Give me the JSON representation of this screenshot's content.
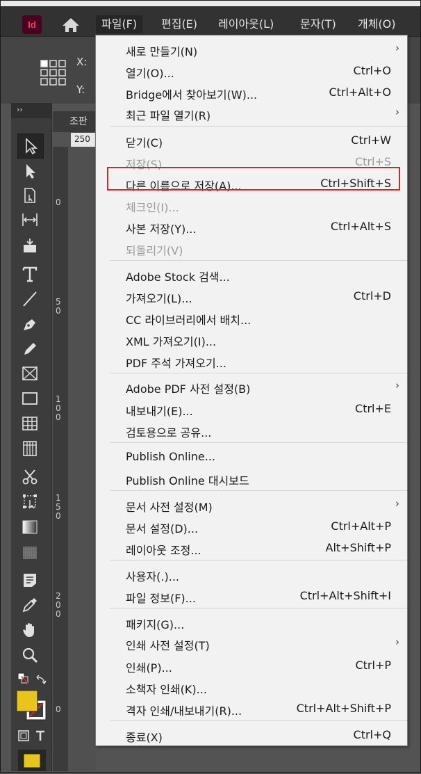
{
  "app": {
    "icon_label": "Id"
  },
  "menubar": {
    "items": [
      {
        "label": "파일(F)"
      },
      {
        "label": "편집(E)"
      },
      {
        "label": "레이아웃(L)"
      },
      {
        "label": "문자(T)"
      },
      {
        "label": "개체(O)"
      }
    ]
  },
  "controlbar": {
    "x_label": "X:",
    "y_label": "Y:"
  },
  "tools": {
    "collapse_label": "››"
  },
  "document": {
    "tab_label": "조판",
    "ruler_h": "250",
    "ruler_v": [
      "0",
      "5 0",
      "1 0 0",
      "1 5 0",
      "2 0 0",
      "0"
    ]
  },
  "file_menu": {
    "items": [
      {
        "label": "새로 만들기(N)",
        "shortcut": "",
        "submenu": "›"
      },
      {
        "label": "열기(O)...",
        "shortcut": "Ctrl+O"
      },
      {
        "label": "Bridge에서 찾아보기(W)...",
        "shortcut": "Ctrl+Alt+O"
      },
      {
        "label": "최근 파일 열기(R)",
        "shortcut": "",
        "submenu": "›"
      },
      {
        "label": "닫기(C)",
        "shortcut": "Ctrl+W"
      },
      {
        "label": "저장(S)",
        "shortcut": "Ctrl+S",
        "disabled": true
      },
      {
        "label": "다른 이름으로 저장(A)...",
        "shortcut": "Ctrl+Shift+S"
      },
      {
        "label": "체크인(I)...",
        "shortcut": "",
        "disabled": true
      },
      {
        "label": "사본 저장(Y)...",
        "shortcut": "Ctrl+Alt+S"
      },
      {
        "label": "되돌리기(V)",
        "shortcut": "",
        "disabled": true
      },
      {
        "label": "Adobe Stock 검색...",
        "shortcut": ""
      },
      {
        "label": "가져오기(L)...",
        "shortcut": "Ctrl+D"
      },
      {
        "label": "CC 라이브러리에서 배치...",
        "shortcut": ""
      },
      {
        "label": "XML 가져오기(I)...",
        "shortcut": ""
      },
      {
        "label": "PDF 주석 가져오기...",
        "shortcut": ""
      },
      {
        "label": "Adobe PDF 사전 설정(B)",
        "shortcut": "",
        "submenu": "›"
      },
      {
        "label": "내보내기(E)...",
        "shortcut": "Ctrl+E"
      },
      {
        "label": "검토용으로 공유...",
        "shortcut": ""
      },
      {
        "label": "Publish Online...",
        "shortcut": ""
      },
      {
        "label": "Publish Online 대시보드",
        "shortcut": ""
      },
      {
        "label": "문서 사전 설정(M)",
        "shortcut": "",
        "submenu": "›"
      },
      {
        "label": "문서 설정(D)...",
        "shortcut": "Ctrl+Alt+P"
      },
      {
        "label": "레이아웃 조정...",
        "shortcut": "Alt+Shift+P"
      },
      {
        "label": "사용자(.)...",
        "shortcut": ""
      },
      {
        "label": "파일 정보(F)...",
        "shortcut": "Ctrl+Alt+Shift+I"
      },
      {
        "label": "패키지(G)...",
        "shortcut": ""
      },
      {
        "label": "인쇄 사전 설정(T)",
        "shortcut": "",
        "submenu": "›"
      },
      {
        "label": "인쇄(P)...",
        "shortcut": "Ctrl+P"
      },
      {
        "label": "소책자 인쇄(K)...",
        "shortcut": ""
      },
      {
        "label": "격자 인쇄/내보내기(R)...",
        "shortcut": "Ctrl+Alt+Shift+P"
      },
      {
        "label": "종료(X)",
        "shortcut": "Ctrl+Q"
      }
    ]
  },
  "colors": {
    "fill_swatch": "#e8c51c",
    "highlight_box": "#e8201c"
  }
}
